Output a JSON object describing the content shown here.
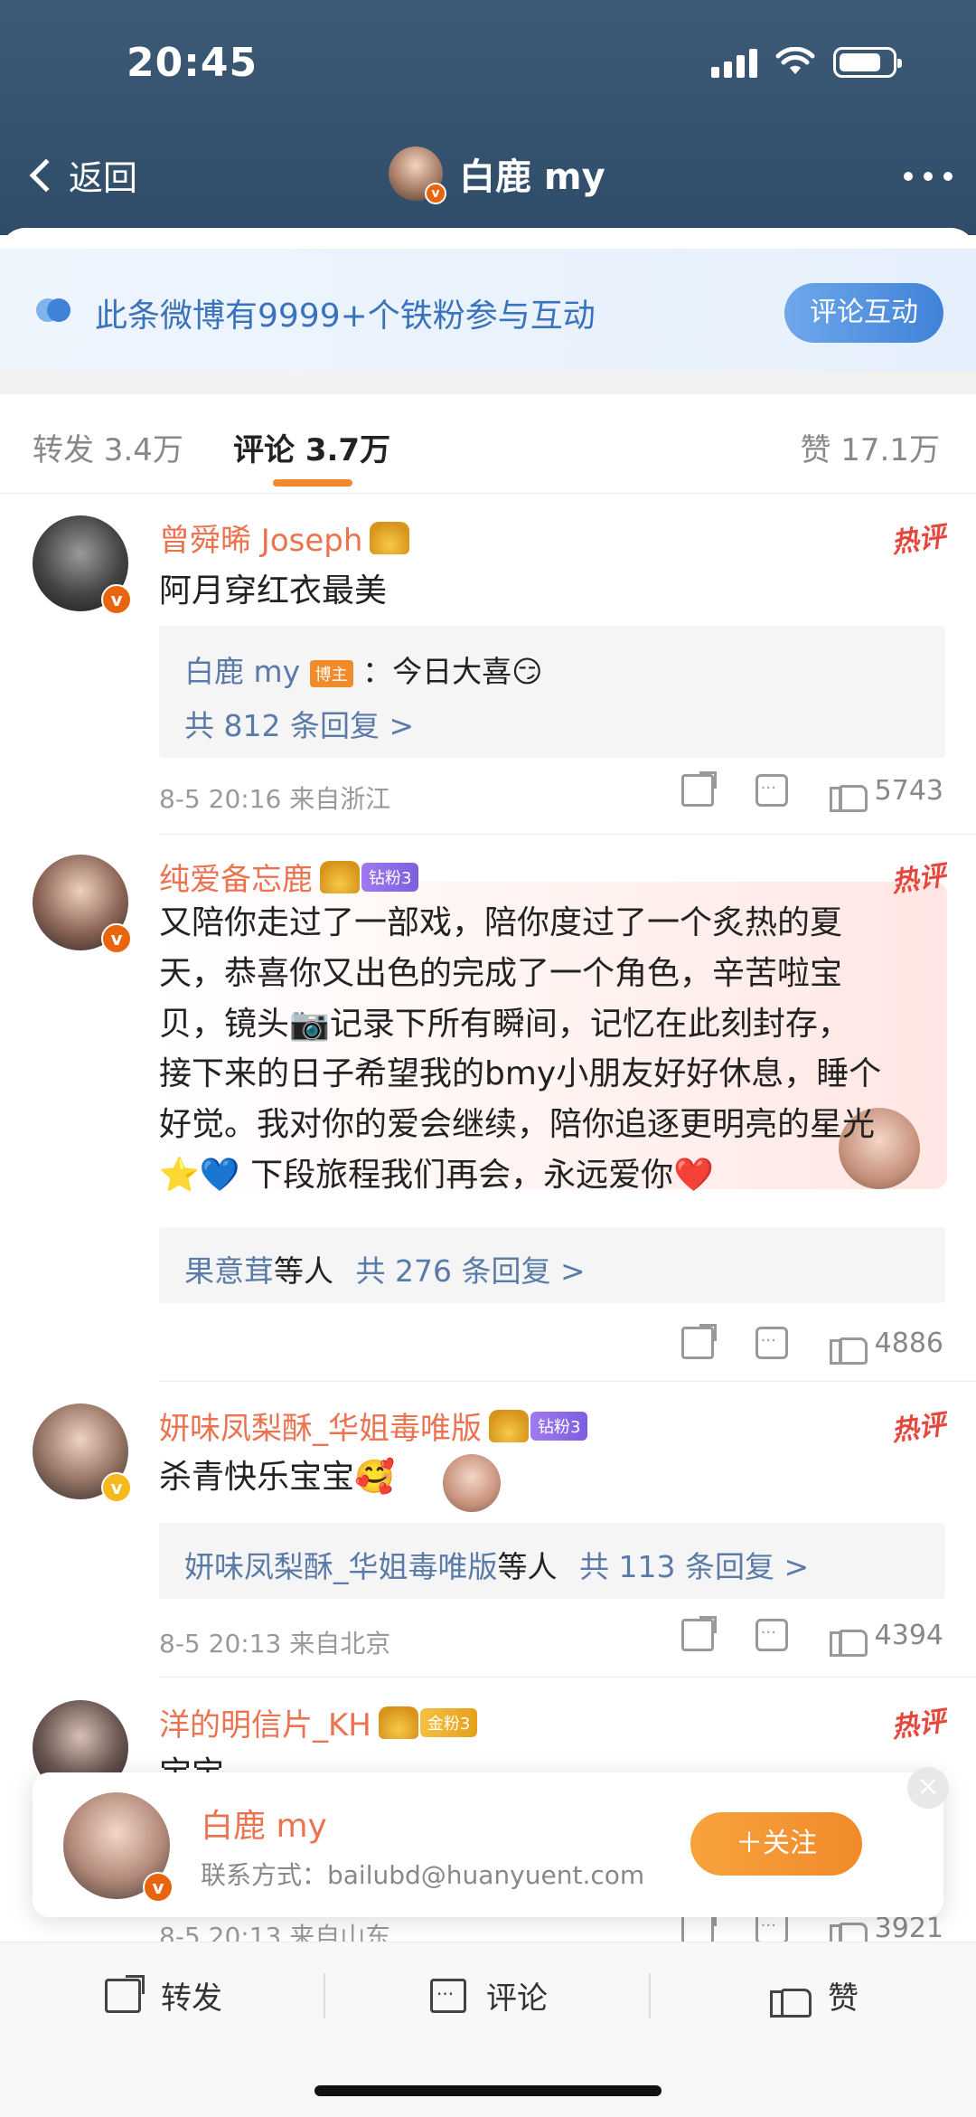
{
  "status_bar": {
    "time": "20:45"
  },
  "nav": {
    "back_label": "返回",
    "title": "白鹿 my"
  },
  "banner": {
    "text": "此条微博有9999+个铁粉参与互动",
    "button": "评论互动"
  },
  "tabs": {
    "repost": "转发 3.4万",
    "comment": "评论 3.7万",
    "like": "赞 17.1万"
  },
  "comments": [
    {
      "name": "曾舜晞 Joseph",
      "hot_label": "热评",
      "text": "阿月穿红衣最美",
      "reply_author": "白鹿 my",
      "reply_host_badge": "博主",
      "reply_text": "：今日大喜😏",
      "reply_count": "共 812 条回复 >",
      "meta": "8-5 20:16  来自浙江",
      "likes": "5743"
    },
    {
      "name": "纯爱备忘鹿",
      "fan_badge": "钻粉3",
      "hot_label": "热评",
      "text_lines": [
        "又陪你走过了一部戏，陪你度过了一个炙热的夏",
        "天，恭喜你又出色的完成了一个角色，辛苦啦宝",
        "贝，镜头📷记录下所有瞬间，记忆在此刻封存，",
        "接下来的日子希望我的bmy小朋友好好休息，睡个",
        "好觉。我对你的爱会继续，陪你追逐更明亮的星光",
        "⭐💙  下段旅程我们再会，永远爱你❤️"
      ],
      "reply_author": "果意茸",
      "reply_mid": "等人",
      "reply_count": "共 276 条回复 >",
      "likes": "4886"
    },
    {
      "name": "妍味凤梨酥_华姐毒唯版",
      "fan_badge": "钻粉3",
      "hot_label": "热评",
      "text": "杀青快乐宝宝🥰",
      "reply_author": "妍味凤梨酥_华姐毒唯版",
      "reply_mid": "等人",
      "reply_count": "共 113 条回复 >",
      "meta": "8-5 20:13  来自北京",
      "likes": "4394"
    },
    {
      "name": "洋的明信片_KH",
      "fan_badge": "金粉3",
      "hot_label": "热评",
      "text": "宝宝",
      "meta": "8-5 20:13  来自山东",
      "likes": "3921"
    }
  ],
  "follow_card": {
    "name": "白鹿 my",
    "contact": "联系方式：bailubd@huanyuent.com",
    "button": "＋关注",
    "close": "×"
  },
  "bottom_bar": {
    "repost": "转发",
    "comment": "评论",
    "like": "赞"
  },
  "colors": {
    "nav_bg": "#2f4c68",
    "accent_orange": "#f08a2b",
    "username_orange": "#eb7350",
    "link_blue": "#5a7ba8",
    "banner_blue": "#3a73bd",
    "hot_red": "#e5473c"
  }
}
